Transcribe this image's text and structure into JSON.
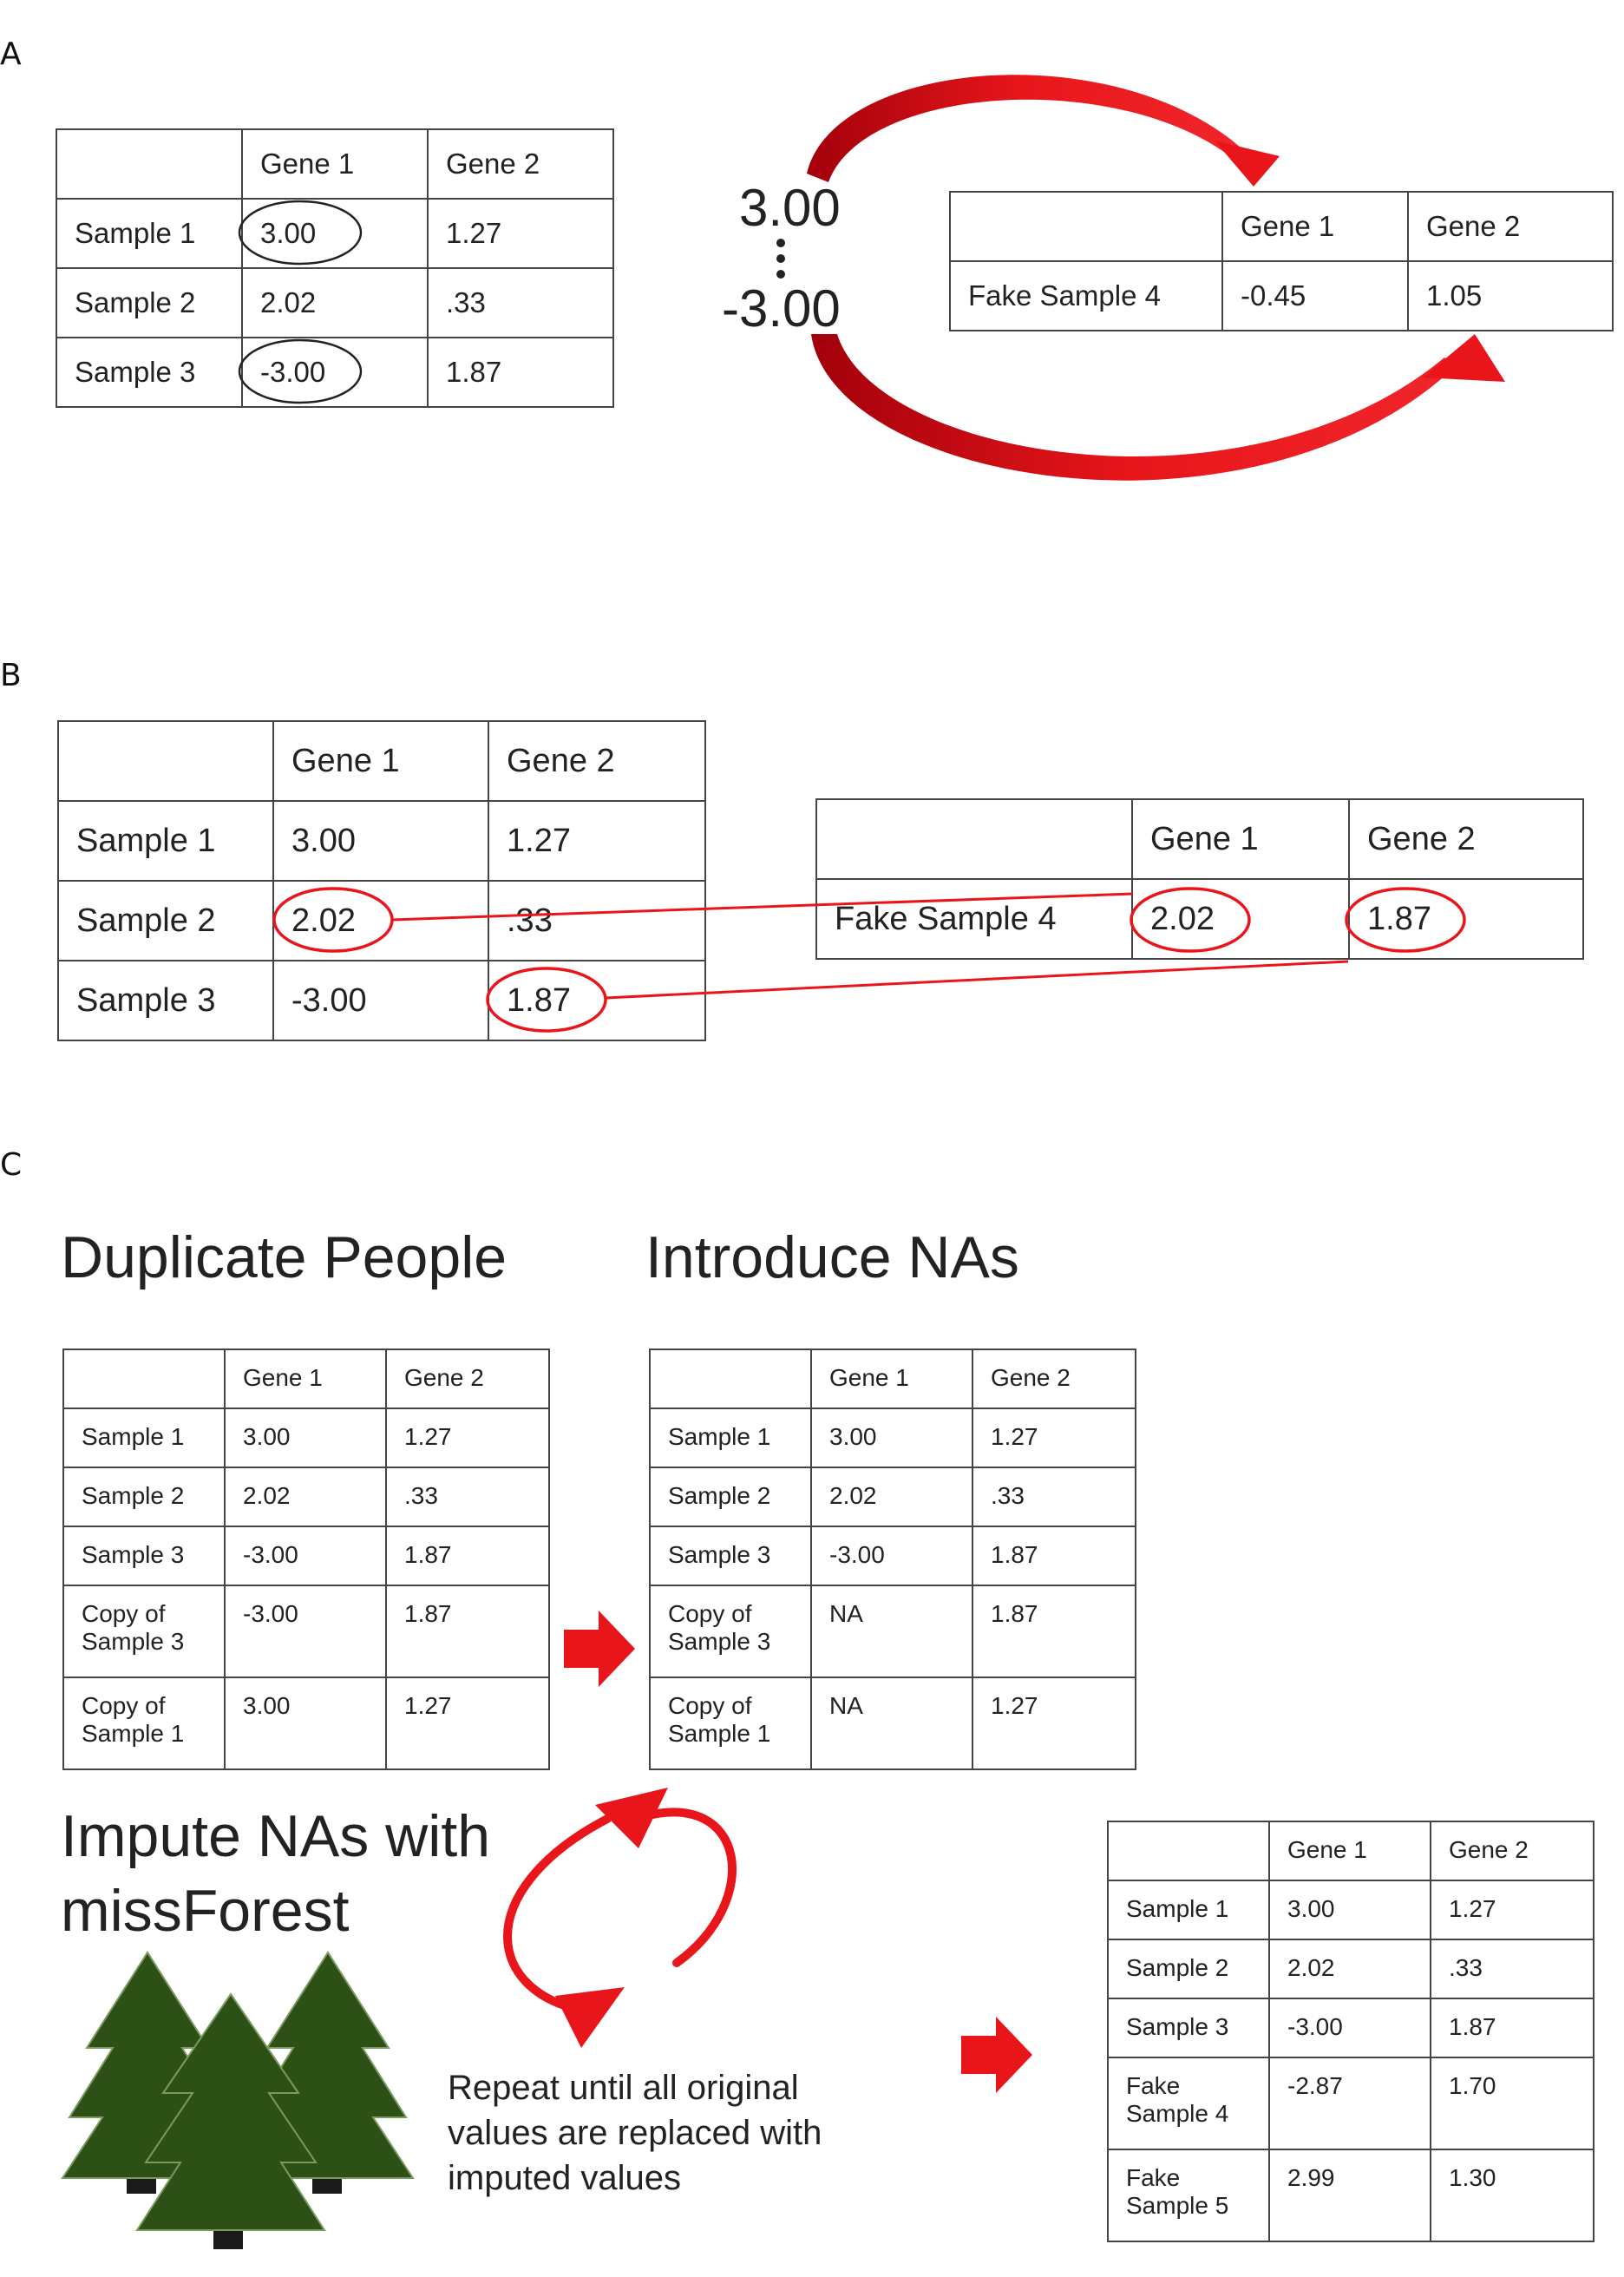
{
  "panels": {
    "a": {
      "letter": "A",
      "header": [
        "",
        "Gene 1",
        "Gene 2"
      ],
      "rows": [
        [
          "Sample 1",
          "3.00",
          "1.27"
        ],
        [
          "Sample 2",
          "2.02",
          ".33"
        ],
        [
          "Sample 3",
          "-3.00",
          "1.87"
        ]
      ],
      "range_top": "3.00",
      "range_bottom": "-3.00",
      "fake": {
        "header": [
          "",
          "Gene 1",
          "Gene 2"
        ],
        "row": [
          "Fake Sample 4",
          "-0.45",
          "1.05"
        ]
      }
    },
    "b": {
      "letter": "B",
      "header": [
        "",
        "Gene 1",
        "Gene 2"
      ],
      "rows": [
        [
          "Sample 1",
          "3.00",
          "1.27"
        ],
        [
          "Sample 2",
          "2.02",
          ".33"
        ],
        [
          "Sample 3",
          "-3.00",
          "1.87"
        ]
      ],
      "fake": {
        "header": [
          "",
          "Gene 1",
          "Gene 2"
        ],
        "row": [
          "Fake Sample 4",
          "2.02",
          "1.87"
        ]
      }
    },
    "c": {
      "letter": "C",
      "step1_title": "Duplicate People",
      "step2_title": "Introduce NAs",
      "step3_title_line1": "Impute NAs with",
      "step3_title_line2": "missForest",
      "repeat_line1": "Repeat until all original",
      "repeat_line2": "values are replaced with",
      "repeat_line3": "imputed values",
      "dup_table": {
        "header": [
          "",
          "Gene 1",
          "Gene 2"
        ],
        "rows": [
          [
            "Sample 1",
            "3.00",
            "1.27"
          ],
          [
            "Sample 2",
            "2.02",
            ".33"
          ],
          [
            "Sample 3",
            "-3.00",
            "1.87"
          ],
          [
            "Copy of Sample 3",
            "-3.00",
            "1.87"
          ],
          [
            "Copy of Sample 1",
            "3.00",
            "1.27"
          ]
        ]
      },
      "na_table": {
        "header": [
          "",
          "Gene 1",
          "Gene 2"
        ],
        "rows": [
          [
            "Sample 1",
            "3.00",
            "1.27"
          ],
          [
            "Sample 2",
            "2.02",
            ".33"
          ],
          [
            "Sample 3",
            "-3.00",
            "1.87"
          ],
          [
            "Copy of Sample 3",
            "NA",
            "1.87"
          ],
          [
            "Copy of Sample 1",
            "NA",
            "1.27"
          ]
        ]
      },
      "result_table": {
        "header": [
          "",
          "Gene 1",
          "Gene 2"
        ],
        "rows": [
          [
            "Sample 1",
            "3.00",
            "1.27"
          ],
          [
            "Sample 2",
            "2.02",
            ".33"
          ],
          [
            "Sample 3",
            "-3.00",
            "1.87"
          ],
          [
            "Fake Sample 4",
            "-2.87",
            "1.70"
          ],
          [
            "Fake Sample 5",
            "2.99",
            "1.30"
          ]
        ]
      }
    }
  },
  "colors": {
    "arrow_red": "#e8161b",
    "arrow_dark_red": "#a3000b",
    "tree_green": "#2d5016",
    "tree_outline": "#7a9a60",
    "trunk": "#1a1a1a"
  }
}
